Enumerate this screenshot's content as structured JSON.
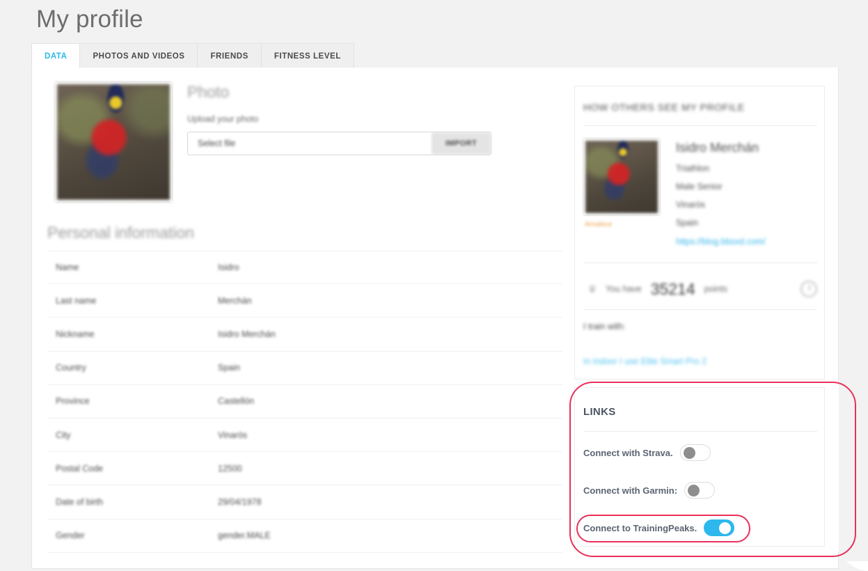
{
  "page": {
    "title": "My profile"
  },
  "tabs": [
    {
      "label": "DATA",
      "active": true
    },
    {
      "label": "PHOTOS AND VIDEOS",
      "active": false
    },
    {
      "label": "FRIENDS",
      "active": false
    },
    {
      "label": "FITNESS LEVEL",
      "active": false
    }
  ],
  "photo": {
    "heading": "Photo",
    "upload_label": "Upload your photo",
    "file_value": "Select file",
    "import_button": "IMPORT"
  },
  "personal_information": {
    "heading": "Personal information",
    "rows": [
      {
        "key": "Name",
        "value": "Isidro"
      },
      {
        "key": "Last name",
        "value": "Merchán"
      },
      {
        "key": "Nickname",
        "value": "Isidro Merchán"
      },
      {
        "key": "Country",
        "value": "Spain"
      },
      {
        "key": "Province",
        "value": "Castellón"
      },
      {
        "key": "City",
        "value": "Vinaròs"
      },
      {
        "key": "Postal Code",
        "value": "12500"
      },
      {
        "key": "Date of birth",
        "value": "29/04/1978"
      },
      {
        "key": "Gender",
        "value": "gender.MALE"
      }
    ]
  },
  "how_others_see": {
    "title": "HOW OTHERS SEE MY PROFILE",
    "badge": "Amateur",
    "name": "Isidro Merchán",
    "sport": "Triathlon",
    "category": "Male Senior",
    "city": "Vinaròs",
    "country": "Spain",
    "url": "https://blog.bbsxd.com/",
    "points": {
      "icon": "trophy-icon",
      "prefix": "You have",
      "value": "35214",
      "unit": "points",
      "clock_icon": "clock-icon"
    },
    "train_with_label": "I train with:",
    "train_with_link": "In indoor I use Elite Smart Pro 2"
  },
  "links": {
    "title": "LINKS",
    "items": [
      {
        "label": "Connect with Strava.",
        "toggle_on": false
      },
      {
        "label": "Connect with Garmin:",
        "toggle_on": false
      },
      {
        "label": "Connect to TrainingPeaks.",
        "toggle_on": true
      }
    ]
  },
  "colors": {
    "accent_cyan": "#2cb8ec",
    "annotation_red": "#e8305a",
    "page_bg": "#f2f2f2",
    "text_gray": "#4d4d4d",
    "badge_orange": "#f0a44e"
  }
}
